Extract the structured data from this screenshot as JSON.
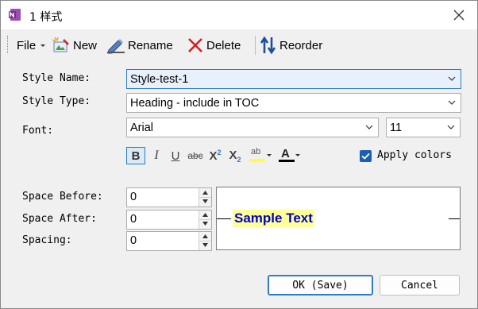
{
  "window": {
    "title": "1 样式"
  },
  "toolbar": {
    "file_label": "File",
    "new_label": "New",
    "rename_label": "Rename",
    "delete_label": "Delete",
    "reorder_label": "Reorder"
  },
  "form": {
    "style_name_label": "Style Name:",
    "style_name_value": "Style-test-1",
    "style_type_label": "Style Type:",
    "style_type_value": "Heading - include in TOC",
    "font_label": "Font:",
    "font_value": "Arial",
    "font_size_value": "11",
    "apply_colors_label": "Apply colors",
    "apply_colors_checked": true,
    "space_before_label": "Space Before:",
    "space_before_value": "0",
    "space_after_label": "Space After:",
    "space_after_value": "0",
    "spacing_label": "Spacing:",
    "spacing_value": "0"
  },
  "format_buttons": {
    "bold": "B",
    "italic": "I",
    "underline": "U",
    "strike": "abc",
    "superscript_base": "X",
    "superscript_mark": "2",
    "subscript_base": "X",
    "subscript_mark": "2",
    "highlight_text": "ab",
    "font_color_text": "A"
  },
  "preview": {
    "sample_text": "Sample Text",
    "highlight_color": "#ffff99",
    "text_color": "#0000cc"
  },
  "buttons": {
    "ok_label": "OK (Save)",
    "cancel_label": "Cancel"
  },
  "colors": {
    "accent": "#2d7ad6",
    "app_icon": "#7a2a8c",
    "delete_red": "#d32020",
    "reorder_blue": "#1f4e9a"
  }
}
